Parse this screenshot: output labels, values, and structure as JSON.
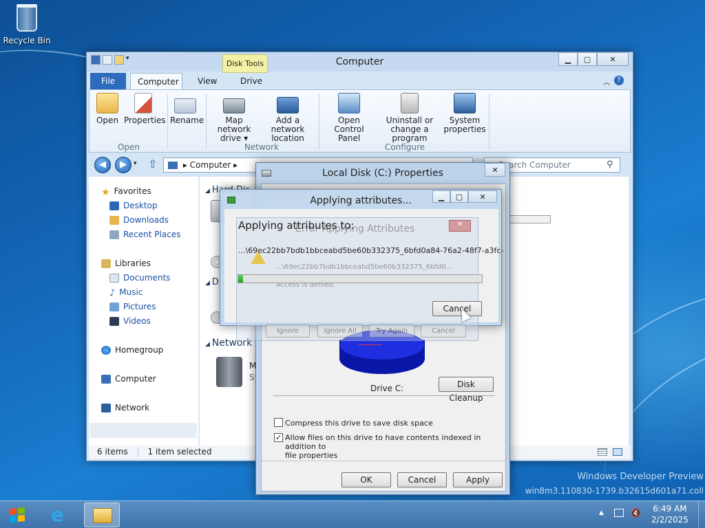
{
  "desktop": {
    "recycle_bin": "Recycle Bin",
    "watermark_line1": "Windows Developer Preview",
    "watermark_line2": "win8m3.110830-1739.b32615d601a71.coll"
  },
  "explorer": {
    "title": "Computer",
    "tabs": {
      "file": "File",
      "computer": "Computer",
      "view": "View",
      "drive": "Drive",
      "contextual": "Disk Tools"
    },
    "ribbon": {
      "open": "Open",
      "properties": "Properties",
      "rename": "Rename",
      "map_network_drive_1": "Map network",
      "map_network_drive_2": "drive ▾",
      "add_network_location_1": "Add a network",
      "add_network_location_2": "location",
      "open_control_panel_1": "Open Control",
      "open_control_panel_2": "Panel",
      "uninstall_1": "Uninstall or",
      "uninstall_2": "change a program",
      "system_properties_1": "System",
      "system_properties_2": "properties",
      "group_open": "Open",
      "group_network": "Network",
      "group_configure": "Configure"
    },
    "address": "Computer",
    "search_placeholder": "Search Computer",
    "nav": {
      "favorites": "Favorites",
      "desktop": "Desktop",
      "downloads": "Downloads",
      "recent_places": "Recent Places",
      "libraries": "Libraries",
      "documents": "Documents",
      "music": "Music",
      "pictures": "Pictures",
      "videos": "Videos",
      "homegroup": "Homegroup",
      "computer": "Computer",
      "network": "Network"
    },
    "content": {
      "hard_disk_header": "Hard Dis",
      "devices_header": "D",
      "network_header": "Network",
      "network_item_label": "M",
      "network_item_sub": "Sy"
    },
    "status": {
      "items": "6 items",
      "selected": "1 item selected"
    }
  },
  "properties_dialog": {
    "title": "Local Disk (C:) Properties",
    "drive_label": "Drive C:",
    "disk_cleanup": "Disk Cleanup",
    "compress_label": "Compress this drive to save disk space",
    "compress_checked": false,
    "index_label_1": "Allow files on this drive to have contents indexed in addition to",
    "index_label_2": "file properties",
    "index_checked": true,
    "ok": "OK",
    "cancel": "Cancel",
    "apply": "Apply"
  },
  "applying_dialog": {
    "title": "Applying attributes...",
    "heading": "Applying attributes to:",
    "path": "...\\69ec22bb7bdb1bbceabd5be60b332375_6bfd0a84-76a2-48f7-a3fc-",
    "progress": 0.02,
    "cancel": "Cancel"
  },
  "error_dialog_ghost": {
    "title": "Error Applying Attributes",
    "path": "...\\69ec22bb7bdb1bbceabd5be60b332375_6bfd0...",
    "message": "Access is denied.",
    "ignore": "Ignore",
    "ignore_all": "Ignore All",
    "try_again": "Try Again",
    "cancel": "Cancel"
  },
  "taskbar": {
    "time": "6:49 AM",
    "date": "2/2/2025"
  },
  "colors": {
    "accent": "#2d6bbd",
    "disk_used": "#1f2fe0"
  }
}
